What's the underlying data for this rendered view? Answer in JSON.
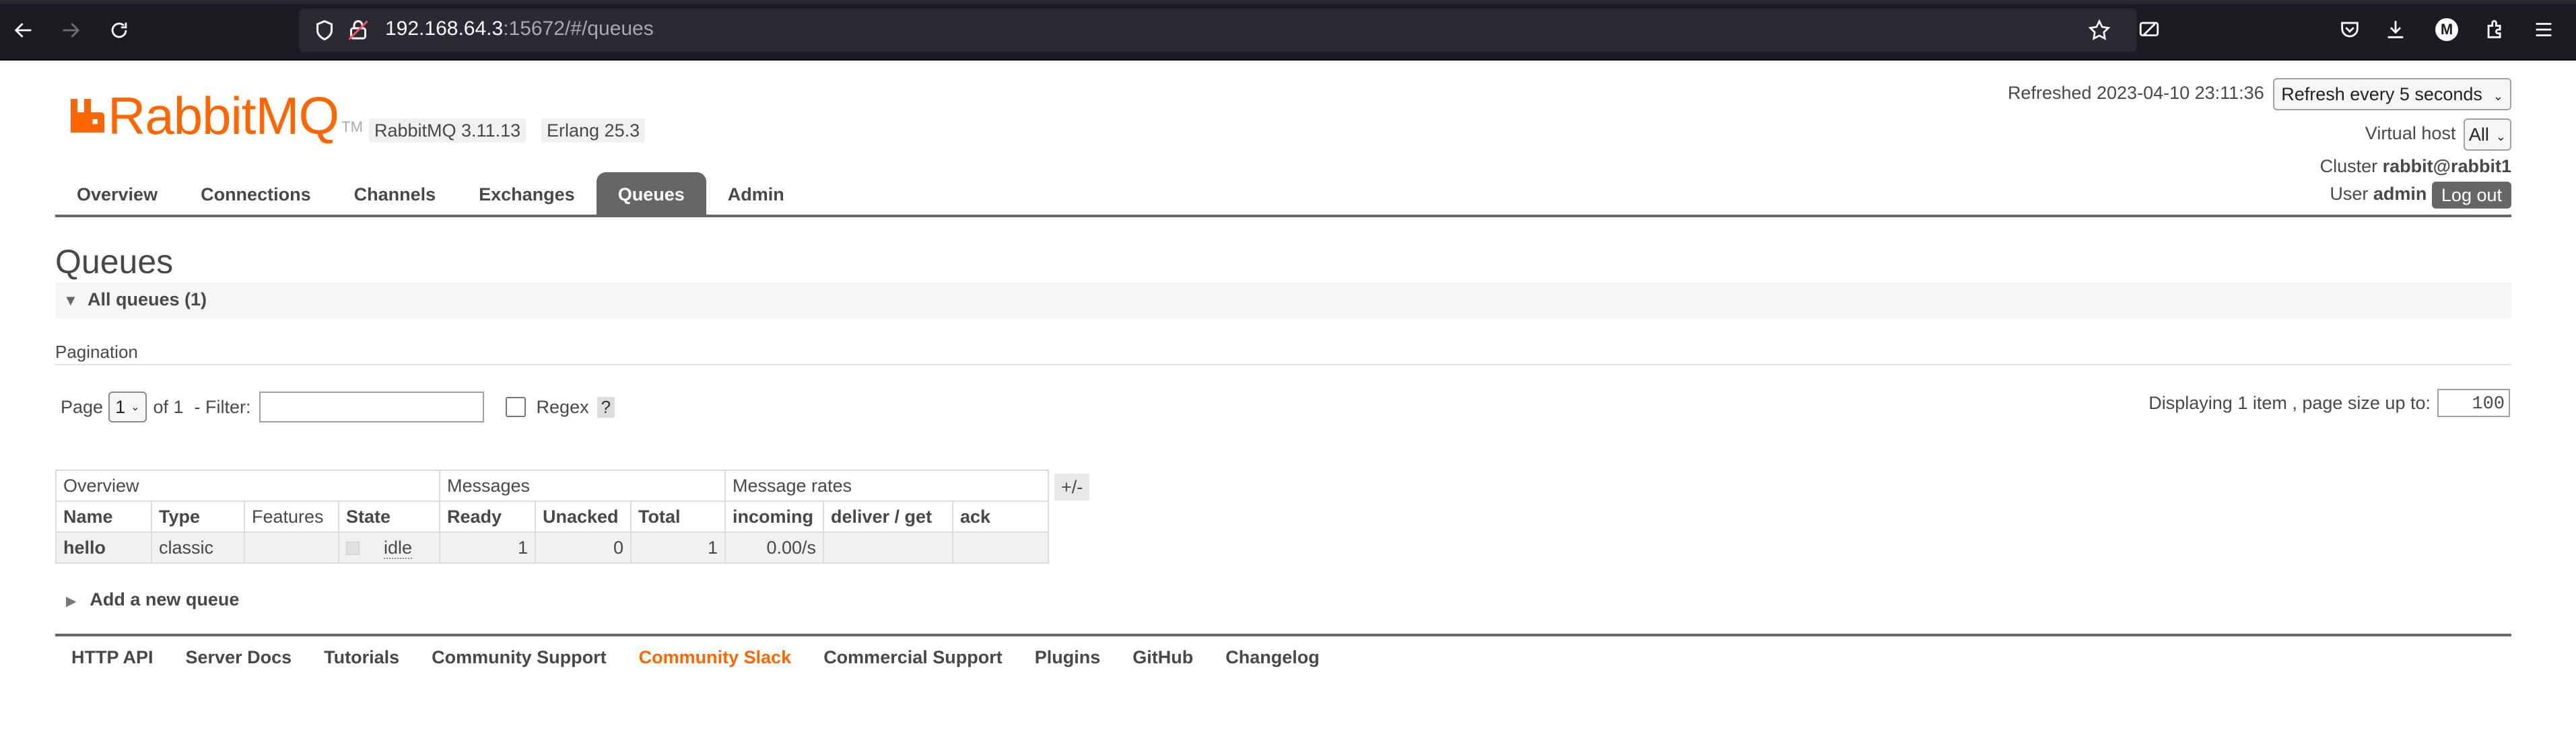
{
  "browser": {
    "url_host": "192.168.64.3",
    "url_rest": ":15672/#/queues",
    "account_initial": "M"
  },
  "header": {
    "logo_text_rabbit": "Rabbit",
    "logo_text_mq": "MQ",
    "logo_tm": "TM",
    "rabbitmq_version": "RabbitMQ 3.11.13",
    "erlang_version": "Erlang 25.3",
    "refreshed_label": "Refreshed 2023-04-10 23:11:36",
    "refresh_select": "Refresh every 5 seconds",
    "vhost_label": "Virtual host",
    "vhost_select": "All",
    "cluster_label": "Cluster",
    "cluster_value": "rabbit@rabbit1",
    "user_label": "User",
    "user_value": "admin",
    "logout_label": "Log out"
  },
  "tabs": [
    {
      "label": "Overview",
      "active": false
    },
    {
      "label": "Connections",
      "active": false
    },
    {
      "label": "Channels",
      "active": false
    },
    {
      "label": "Exchanges",
      "active": false
    },
    {
      "label": "Queues",
      "active": true
    },
    {
      "label": "Admin",
      "active": false
    }
  ],
  "main": {
    "title": "Queues",
    "section_label": "All queues (1)",
    "pagination_title": "Pagination",
    "page_label": "Page",
    "page_select": "1",
    "of_label": "of 1",
    "filter_label": "- Filter:",
    "filter_value": "",
    "regex_label": "Regex",
    "help_label": "?",
    "display_label": "Displaying 1 item , page size up to:",
    "page_size": "100",
    "add_queue_label": "Add a new queue",
    "plus_minus": "+/-"
  },
  "table": {
    "groups": [
      "Overview",
      "Messages",
      "Message rates"
    ],
    "columns": [
      "Name",
      "Type",
      "Features",
      "State",
      "Ready",
      "Unacked",
      "Total",
      "incoming",
      "deliver / get",
      "ack"
    ],
    "rows": [
      {
        "name": "hello",
        "type": "classic",
        "features": "",
        "state": "idle",
        "ready": "1",
        "unacked": "0",
        "total": "1",
        "incoming": "0.00/s",
        "deliver_get": "",
        "ack": ""
      }
    ]
  },
  "footer": {
    "links": [
      "HTTP API",
      "Server Docs",
      "Tutorials",
      "Community Support",
      "Community Slack",
      "Commercial Support",
      "Plugins",
      "GitHub",
      "Changelog"
    ],
    "highlight_index": 4
  },
  "colors": {
    "brand_orange": "#ff6600",
    "tab_active": "#666666",
    "text": "#484848",
    "browser_chrome": "#1c1b22"
  }
}
